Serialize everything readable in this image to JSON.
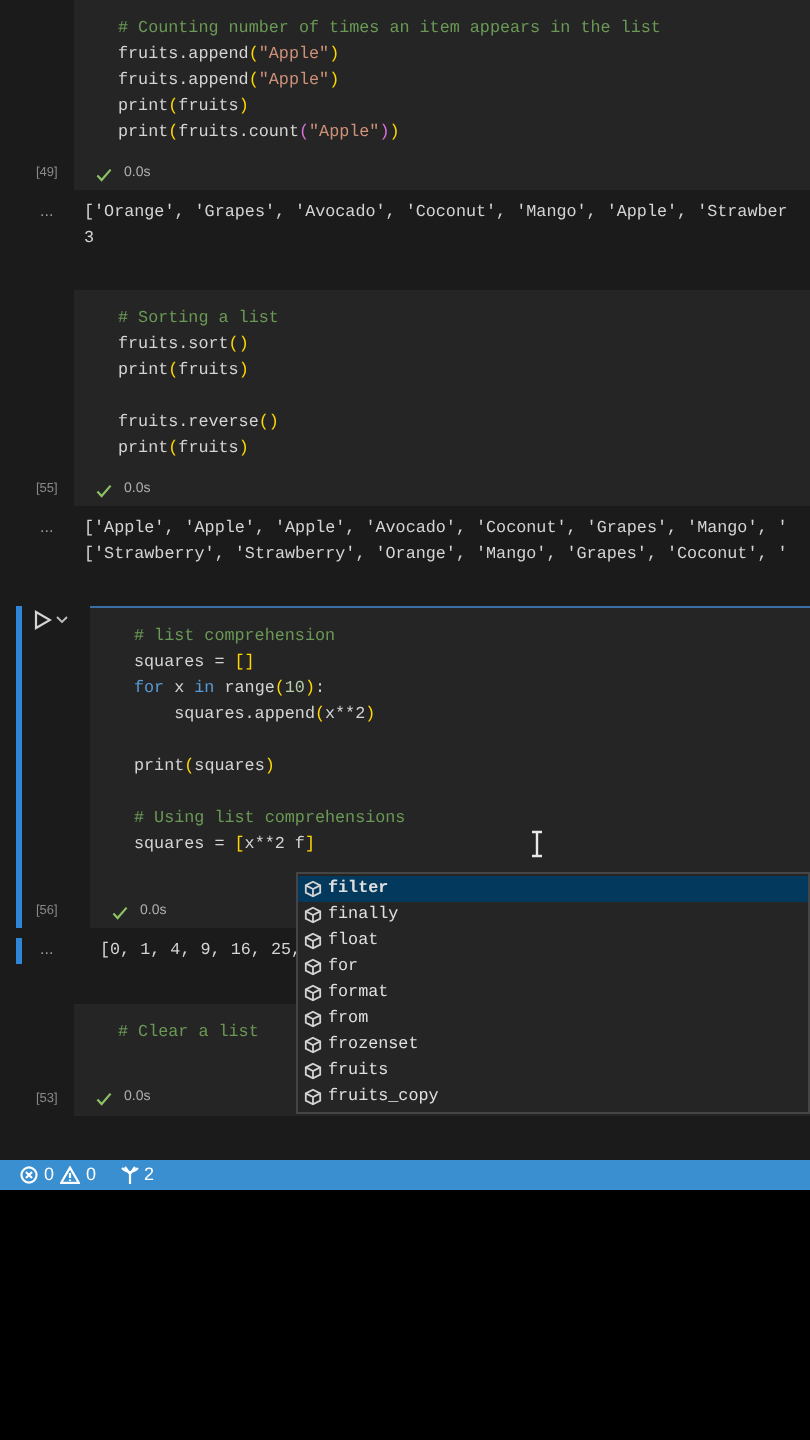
{
  "cells": [
    {
      "exec_count": "[49]",
      "time": "0.0s",
      "selected": false,
      "lines": [
        {
          "kind": "code",
          "tokens": [
            {
              "kind": "comment",
              "text": "# Counting number of times an item appears in the list"
            }
          ]
        },
        {
          "kind": "code",
          "tokens": [
            {
              "kind": "plain",
              "text": "fruits.append"
            },
            {
              "kind": "bracket",
              "text": "("
            },
            {
              "kind": "string",
              "text": "\"Apple\""
            },
            {
              "kind": "bracket",
              "text": ")"
            }
          ]
        },
        {
          "kind": "code",
          "tokens": [
            {
              "kind": "plain",
              "text": "fruits.append"
            },
            {
              "kind": "bracket",
              "text": "("
            },
            {
              "kind": "string",
              "text": "\"Apple\""
            },
            {
              "kind": "bracket",
              "text": ")"
            }
          ]
        },
        {
          "kind": "code",
          "tokens": [
            {
              "kind": "plain",
              "text": "print"
            },
            {
              "kind": "bracket",
              "text": "("
            },
            {
              "kind": "plain",
              "text": "fruits"
            },
            {
              "kind": "bracket",
              "text": ")"
            }
          ]
        },
        {
          "kind": "code",
          "tokens": [
            {
              "kind": "plain",
              "text": "print"
            },
            {
              "kind": "bracket",
              "text": "("
            },
            {
              "kind": "plain",
              "text": "fruits.count"
            },
            {
              "kind": "bracket2",
              "text": "("
            },
            {
              "kind": "string",
              "text": "\"Apple\""
            },
            {
              "kind": "bracket2",
              "text": ")"
            },
            {
              "kind": "bracket",
              "text": ")"
            }
          ]
        }
      ],
      "output_marker": "...",
      "outputs": [
        "['Orange', 'Grapes', 'Avocado', 'Coconut', 'Mango', 'Apple', 'Strawber",
        "3"
      ]
    },
    {
      "exec_count": "[55]",
      "time": "0.0s",
      "selected": false,
      "lines": [
        {
          "kind": "code",
          "tokens": [
            {
              "kind": "comment",
              "text": "# Sorting a list"
            }
          ]
        },
        {
          "kind": "code",
          "tokens": [
            {
              "kind": "plain",
              "text": "fruits.sort"
            },
            {
              "kind": "bracket",
              "text": "()"
            }
          ]
        },
        {
          "kind": "code",
          "tokens": [
            {
              "kind": "plain",
              "text": "print"
            },
            {
              "kind": "bracket",
              "text": "("
            },
            {
              "kind": "plain",
              "text": "fruits"
            },
            {
              "kind": "bracket",
              "text": ")"
            }
          ]
        },
        {
          "kind": "blank"
        },
        {
          "kind": "code",
          "tokens": [
            {
              "kind": "plain",
              "text": "fruits.reverse"
            },
            {
              "kind": "bracket",
              "text": "()"
            }
          ]
        },
        {
          "kind": "code",
          "tokens": [
            {
              "kind": "plain",
              "text": "print"
            },
            {
              "kind": "bracket",
              "text": "("
            },
            {
              "kind": "plain",
              "text": "fruits"
            },
            {
              "kind": "bracket",
              "text": ")"
            }
          ]
        }
      ],
      "output_marker": "...",
      "outputs": [
        "['Apple', 'Apple', 'Apple', 'Avocado', 'Coconut', 'Grapes', 'Mango', '",
        "['Strawberry', 'Strawberry', 'Orange', 'Mango', 'Grapes', 'Coconut', '"
      ]
    },
    {
      "exec_count": "[56]",
      "time": "0.0s",
      "selected": true,
      "lines": [
        {
          "kind": "code",
          "tokens": [
            {
              "kind": "comment",
              "text": "# list comprehension"
            }
          ]
        },
        {
          "kind": "code",
          "tokens": [
            {
              "kind": "plain",
              "text": "squares = "
            },
            {
              "kind": "bracket",
              "text": "[]"
            }
          ]
        },
        {
          "kind": "code",
          "tokens": [
            {
              "kind": "keyword",
              "text": "for"
            },
            {
              "kind": "plain",
              "text": " x "
            },
            {
              "kind": "keyword",
              "text": "in"
            },
            {
              "kind": "plain",
              "text": " range"
            },
            {
              "kind": "bracket",
              "text": "("
            },
            {
              "kind": "number",
              "text": "10"
            },
            {
              "kind": "bracket",
              "text": ")"
            },
            {
              "kind": "plain",
              "text": ":"
            }
          ]
        },
        {
          "kind": "code",
          "tokens": [
            {
              "kind": "plain",
              "text": "    squares.append"
            },
            {
              "kind": "bracket",
              "text": "("
            },
            {
              "kind": "plain",
              "text": "x**2"
            },
            {
              "kind": "bracket",
              "text": ")"
            }
          ]
        },
        {
          "kind": "blank"
        },
        {
          "kind": "code",
          "tokens": [
            {
              "kind": "plain",
              "text": "print"
            },
            {
              "kind": "bracket",
              "text": "("
            },
            {
              "kind": "plain",
              "text": "squares"
            },
            {
              "kind": "bracket",
              "text": ")"
            }
          ]
        },
        {
          "kind": "blank"
        },
        {
          "kind": "code",
          "tokens": [
            {
              "kind": "comment",
              "text": "# Using list comprehensions"
            }
          ]
        },
        {
          "kind": "code",
          "tokens": [
            {
              "kind": "plain",
              "text": "squares = "
            },
            {
              "kind": "bracket",
              "text": "["
            },
            {
              "kind": "plain",
              "text": "x**2 f"
            },
            {
              "kind": "bracket",
              "text": "]"
            }
          ]
        },
        {
          "kind": "blank"
        }
      ],
      "output_marker": "...",
      "outputs": [
        "[0, 1, 4, 9, 16, 25,"
      ]
    },
    {
      "exec_count": "[53]",
      "time": "0.0s",
      "selected": false,
      "lines": [
        {
          "kind": "code",
          "tokens": [
            {
              "kind": "comment",
              "text": "# Clear a list"
            }
          ]
        },
        {
          "kind": "blank"
        }
      ]
    }
  ],
  "suggestions": [
    {
      "label": "filter",
      "selected": true
    },
    {
      "label": "finally",
      "selected": false
    },
    {
      "label": "float",
      "selected": false
    },
    {
      "label": "for",
      "selected": false
    },
    {
      "label": "format",
      "selected": false
    },
    {
      "label": "from",
      "selected": false
    },
    {
      "label": "frozenset",
      "selected": false
    },
    {
      "label": "fruits",
      "selected": false
    },
    {
      "label": "fruits_copy",
      "selected": false
    }
  ],
  "status_bar": {
    "errors": "0",
    "warnings": "0",
    "ports": "2"
  }
}
